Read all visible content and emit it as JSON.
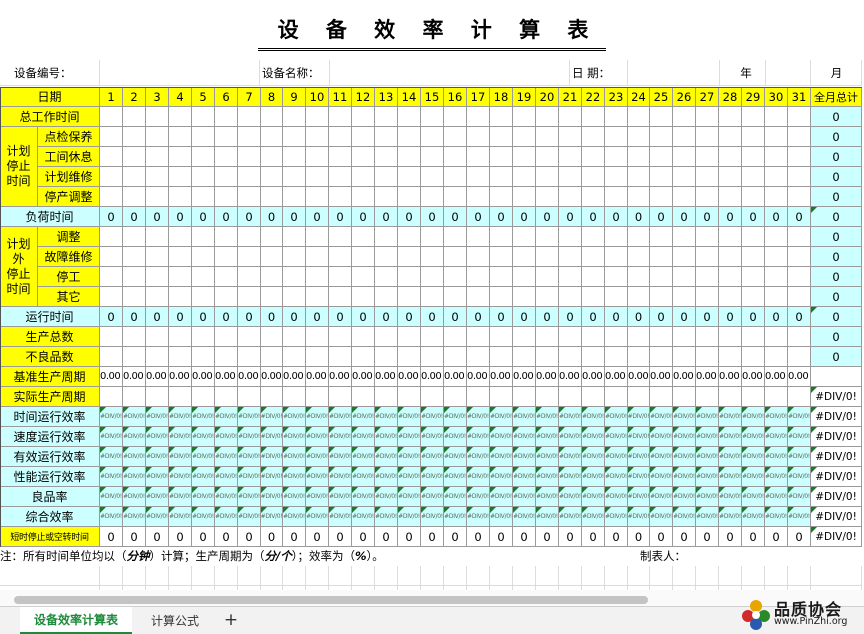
{
  "title": "设 备 效 率 计 算 表",
  "header": {
    "equip_no_label": "设备编号：",
    "equip_name_label": "设备名称：",
    "date_label": "日 期：",
    "year_label": "年",
    "month_label": "月"
  },
  "table": {
    "date_label": "日期",
    "days": [
      "1",
      "2",
      "3",
      "4",
      "5",
      "6",
      "7",
      "8",
      "9",
      "10",
      "11",
      "12",
      "13",
      "14",
      "15",
      "16",
      "17",
      "18",
      "19",
      "20",
      "21",
      "22",
      "23",
      "24",
      "25",
      "26",
      "27",
      "28",
      "29",
      "30",
      "31"
    ],
    "total_label": "全月总计",
    "rows": [
      {
        "label": "总工作时间",
        "group": "",
        "style": "y",
        "fill": "blank",
        "total": "0"
      },
      {
        "label": "点检保养",
        "group": "计划停止时间",
        "style": "y",
        "fill": "blank",
        "total": "0"
      },
      {
        "label": "工间休息",
        "group": "计划停止时间",
        "style": "y",
        "fill": "blank",
        "total": "0"
      },
      {
        "label": "计划维修",
        "group": "计划停止时间",
        "style": "y",
        "fill": "blank",
        "total": "0"
      },
      {
        "label": "停产调整",
        "group": "计划停止时间",
        "style": "y",
        "fill": "blank",
        "total": "0"
      },
      {
        "label": "负荷时间",
        "group": "",
        "style": "c",
        "fill": "0",
        "total": "0"
      },
      {
        "label": "调整",
        "group": "计划外停止时间",
        "style": "y",
        "fill": "blank",
        "total": "0"
      },
      {
        "label": "故障维修",
        "group": "计划外停止时间",
        "style": "y",
        "fill": "blank",
        "total": "0"
      },
      {
        "label": "停工",
        "group": "计划外停止时间",
        "style": "y",
        "fill": "blank",
        "total": "0"
      },
      {
        "label": "其它",
        "group": "计划外停止时间",
        "style": "y",
        "fill": "blank",
        "total": "0"
      },
      {
        "label": "运行时间",
        "group": "",
        "style": "c",
        "fill": "0",
        "total": "0"
      },
      {
        "label": "生产总数",
        "group": "",
        "style": "y",
        "fill": "blank",
        "total": "0"
      },
      {
        "label": "不良品数",
        "group": "",
        "style": "y",
        "fill": "blank",
        "total": "0"
      },
      {
        "label": "基准生产周期",
        "group": "",
        "style": "y",
        "fill": "0.00",
        "total": ""
      },
      {
        "label": "实际生产周期",
        "group": "",
        "style": "y",
        "fill": "blank",
        "total": "#DIV/0!"
      },
      {
        "label": "时间运行效率",
        "group": "",
        "style": "c",
        "fill": "#DIV/0!",
        "total": "#DIV/0!"
      },
      {
        "label": "速度运行效率",
        "group": "",
        "style": "c",
        "fill": "#DIV/0!",
        "total": "#DIV/0!"
      },
      {
        "label": "有效运行效率",
        "group": "",
        "style": "c",
        "fill": "#DIV/0!",
        "total": "#DIV/0!"
      },
      {
        "label": "性能运行效率",
        "group": "",
        "style": "c",
        "fill": "#DIV/0!",
        "total": "#DIV/0!"
      },
      {
        "label": "良品率",
        "group": "",
        "style": "c",
        "fill": "#DIV/0!",
        "total": "#DIV/0!"
      },
      {
        "label": "综合效率",
        "group": "",
        "style": "c",
        "fill": "#DIV/0!",
        "total": "#DIV/0!"
      },
      {
        "label": "短时停止或空转时间",
        "group": "",
        "style": "y",
        "fill": "0",
        "total": "#DIV/0!"
      }
    ],
    "group_plan_label": "计划\n停止\n时间",
    "group_unplan_label": "计划\n外\n停止\n时间"
  },
  "note": {
    "text1": "注：所有时间单位均以（",
    "unit1": "分钟",
    "text2": "）计算；生产周期为（",
    "unit2": "分/个",
    "text3": "）；效率为（",
    "unit3": "%",
    "text4": "）。",
    "maker_label": "制表人："
  },
  "tabs": [
    "设备效率计算表",
    "计算公式"
  ],
  "add_tab_icon": "plus-icon",
  "logo": {
    "name": "品质协会",
    "url": "www.PinZhi.org"
  },
  "colors": {
    "yellow": "#ffff00",
    "cyan": "#ccffff",
    "tab_green": "#1e8a3c"
  }
}
